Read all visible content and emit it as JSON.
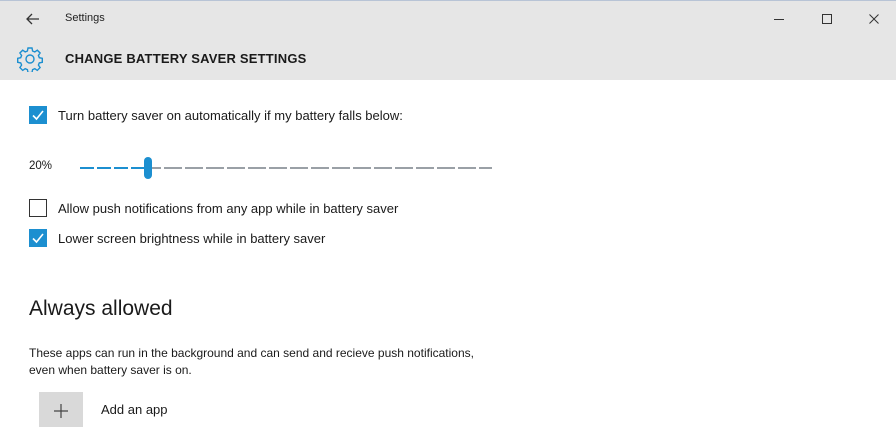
{
  "window": {
    "title": "Settings",
    "back_icon": "back-arrow-icon",
    "minimize_icon": "minimize-icon",
    "maximize_icon": "maximize-icon",
    "close_icon": "close-icon"
  },
  "header": {
    "icon": "gear-icon",
    "title": "CHANGE BATTERY SAVER SETTINGS"
  },
  "settings": {
    "auto_on": {
      "label": "Turn battery saver on automatically if my battery falls below:",
      "checked": true
    },
    "threshold": {
      "value_label": "20%",
      "value_percent": 20
    },
    "push_notifications": {
      "label": "Allow push notifications from any app while in battery saver",
      "checked": false
    },
    "lower_brightness": {
      "label": "Lower screen brightness while in battery saver",
      "checked": true
    }
  },
  "always_allowed": {
    "title": "Always allowed",
    "description": "These apps can run in the background and can send and recieve push notifications, even when battery saver is on.",
    "add_icon": "plus-icon",
    "add_label": "Add an app"
  },
  "colors": {
    "accent": "#1c8fd0",
    "titlebar_bg": "#e6e6e6"
  }
}
